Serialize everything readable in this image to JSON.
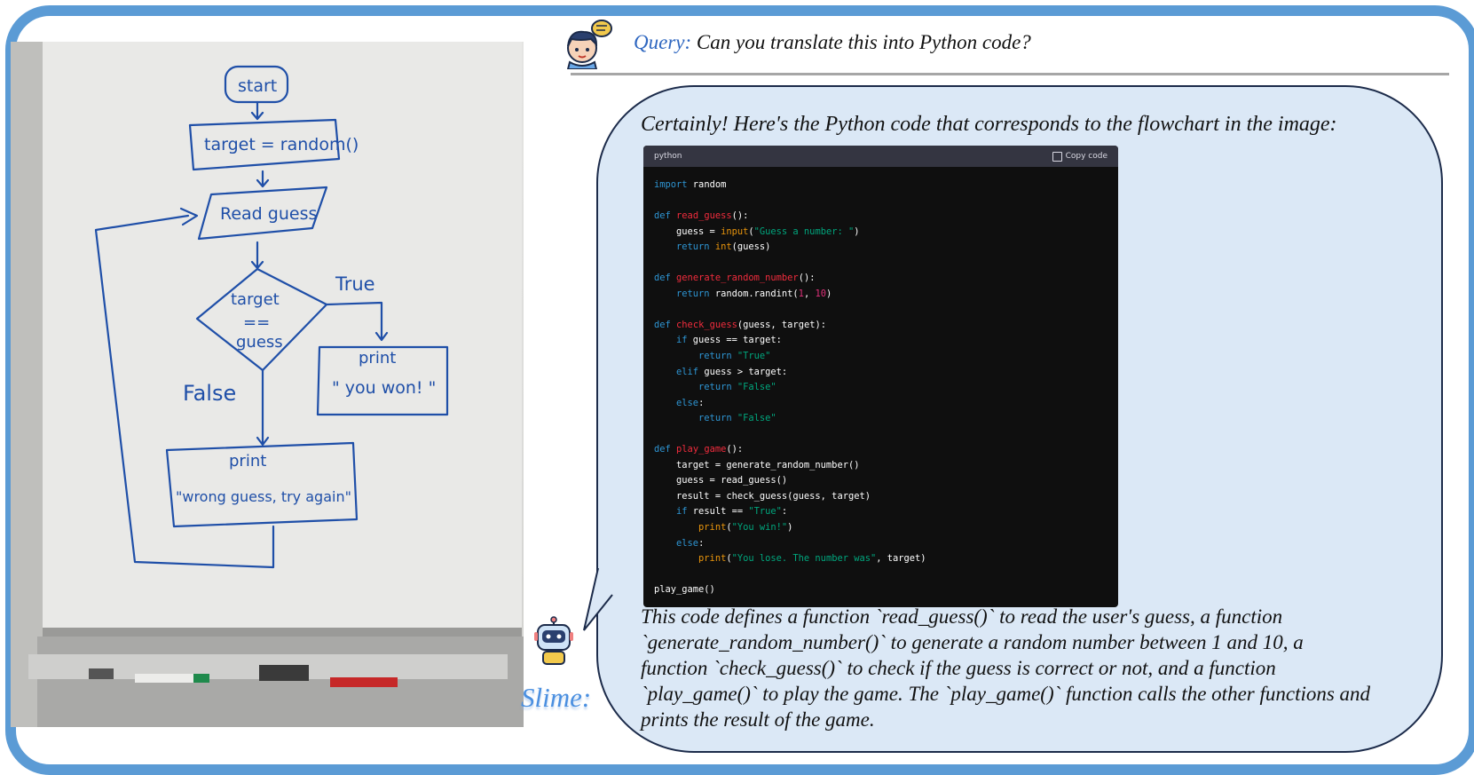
{
  "query": {
    "label": "Query:",
    "text": "Can you translate this into Python code?"
  },
  "whiteboard": {
    "start": "start",
    "assign": "target = random()",
    "read": "Read guess",
    "condition_line1": "target",
    "condition_line2": "==",
    "condition_line3": "guess",
    "true_label": "True",
    "false_label": "False",
    "print_win_line1": "print",
    "print_win_line2": "\" you won! \"",
    "print_lose_line1": "print",
    "print_lose_line2": "\"wrong guess, try again\""
  },
  "response": {
    "intro": "Certainly! Here's the Python code that corresponds to the flowchart in the image:",
    "code_language": "python",
    "copy_label": "Copy code",
    "explanation_lines": [
      "This code defines a function `read_guess()` to read the user's guess, a function",
      "`generate_random_number()` to generate a random number between 1 and 10, a",
      "function `check_guess()` to check if the guess is correct or not, and a function",
      "`play_game()` to play the game. The `play_game()` function calls the other functions and",
      "prints the result of the game."
    ]
  },
  "assistant_name": "Slime:",
  "icons": [
    "user-avatar-icon",
    "speech-bubble-icon",
    "robot-icon",
    "copy-icon"
  ],
  "colors": {
    "frame": "#5b9bd5",
    "bubble": "#dbe8f6",
    "code_bg": "#0f0f0f",
    "keyword": "#2e95d3",
    "function": "#f22c3d",
    "builtin": "#e9950c",
    "string": "#00a67d",
    "number": "#df3079",
    "marker": "#1f4fa8"
  }
}
